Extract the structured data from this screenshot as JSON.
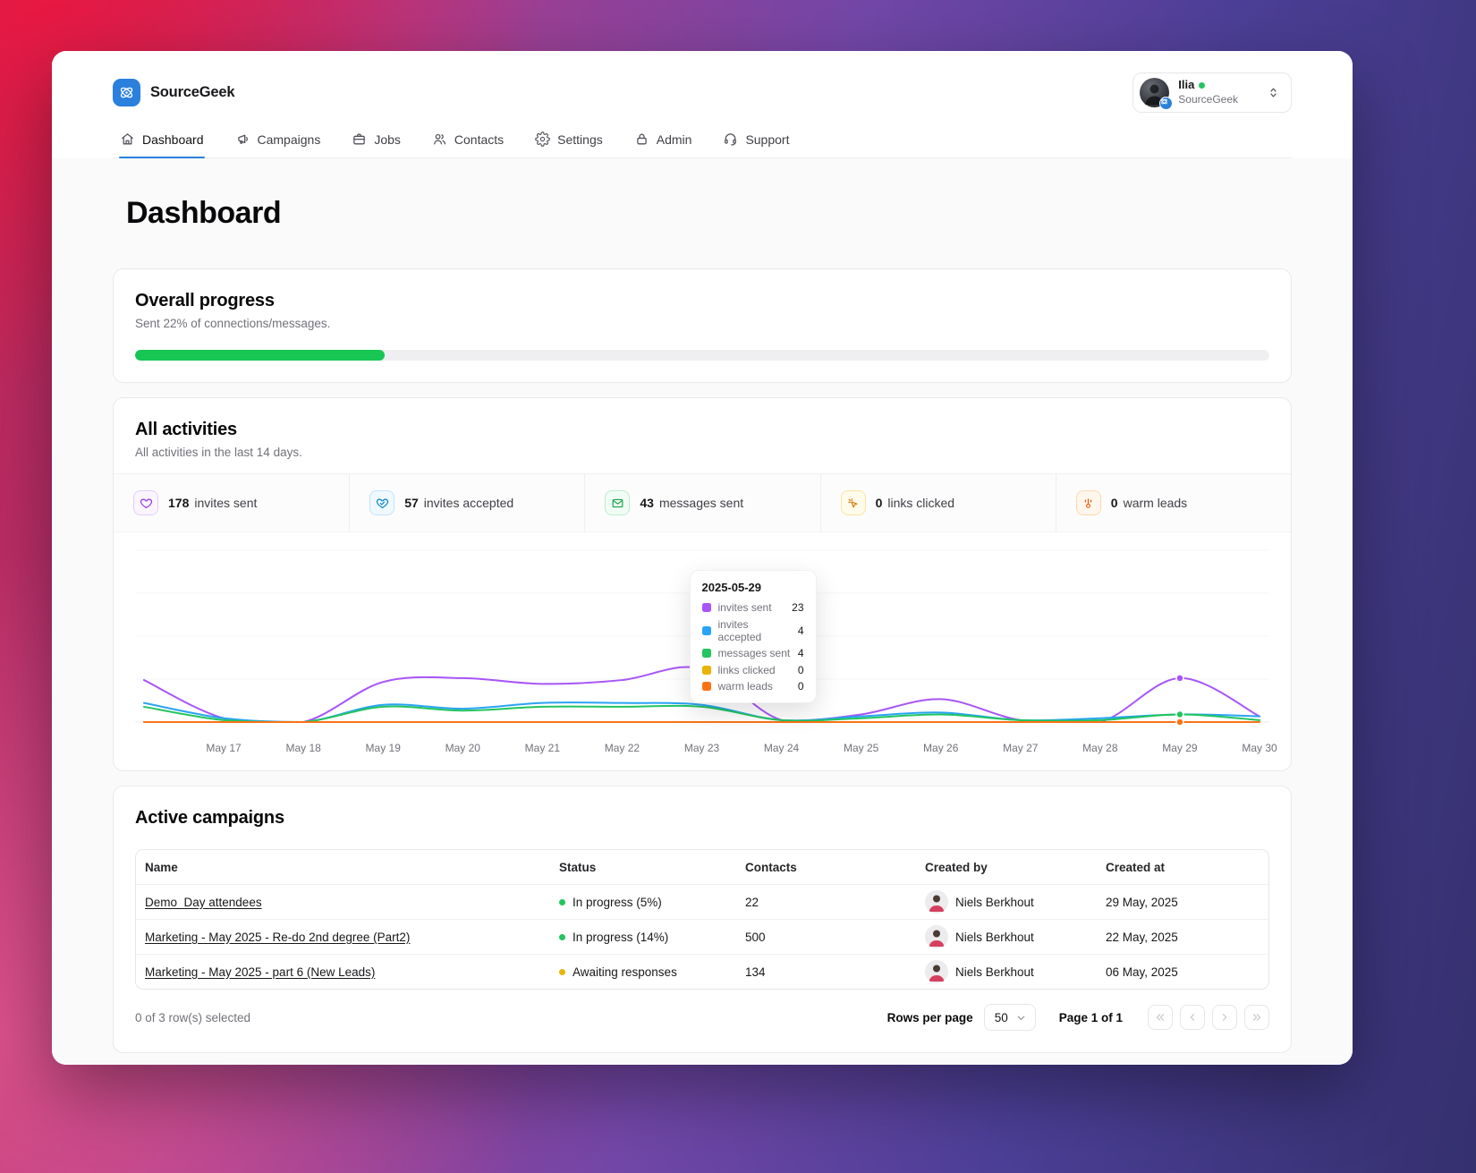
{
  "brand": {
    "name": "SourceGeek"
  },
  "account": {
    "name": "Ilia",
    "org": "SourceGeek",
    "status_color": "#22c55e"
  },
  "nav": {
    "items": [
      {
        "label": "Dashboard",
        "active": true
      },
      {
        "label": "Campaigns",
        "active": false
      },
      {
        "label": "Jobs",
        "active": false
      },
      {
        "label": "Contacts",
        "active": false
      },
      {
        "label": "Settings",
        "active": false
      },
      {
        "label": "Admin",
        "active": false
      },
      {
        "label": "Support",
        "active": false
      }
    ]
  },
  "page": {
    "title": "Dashboard"
  },
  "overall_progress": {
    "title": "Overall progress",
    "subtitle": "Sent 22% of connections/messages.",
    "percent": 22,
    "bar_color": "#17c653"
  },
  "activities": {
    "title": "All activities",
    "subtitle": "All activities in the last 14 days.",
    "stats": [
      {
        "value": "178",
        "label": "invites sent"
      },
      {
        "value": "57",
        "label": "invites accepted"
      },
      {
        "value": "43",
        "label": "messages sent"
      },
      {
        "value": "0",
        "label": "links clicked"
      },
      {
        "value": "0",
        "label": "warm leads"
      }
    ]
  },
  "chart_data": {
    "type": "line",
    "title": "All activities (last 14 days)",
    "xlabel": "",
    "ylabel": "",
    "ylim": [
      0,
      90
    ],
    "grid": true,
    "legend_position": "tooltip-only",
    "categories": [
      "May 17",
      "May 18",
      "May 19",
      "May 20",
      "May 21",
      "May 22",
      "May 23",
      "May 24",
      "May 25",
      "May 26",
      "May 27",
      "May 28",
      "May 29",
      "May 30"
    ],
    "note": "lines begin at unlabeled left edge (May 16); edge value given per series",
    "series": [
      {
        "name": "invites sent",
        "color": "#a855f7",
        "edge": 22,
        "values": [
          2,
          0,
          21,
          23,
          20,
          22,
          28,
          1,
          4,
          12,
          1,
          0,
          23,
          3
        ]
      },
      {
        "name": "invites accepted",
        "color": "#29a3f4",
        "edge": 10,
        "values": [
          2,
          0,
          9,
          7,
          10,
          10,
          9,
          1,
          3,
          5,
          1,
          2,
          4,
          3
        ]
      },
      {
        "name": "messages sent",
        "color": "#22c55e",
        "edge": 8,
        "values": [
          1,
          0,
          8,
          6,
          8,
          8,
          8,
          1,
          2,
          4,
          1,
          1,
          4,
          1
        ]
      },
      {
        "name": "links clicked",
        "color": "#eab308",
        "edge": 0,
        "values": [
          0,
          0,
          0,
          0,
          0,
          0,
          0,
          0,
          0,
          0,
          0,
          0,
          0,
          0
        ]
      },
      {
        "name": "warm leads",
        "color": "#f97316",
        "edge": 0,
        "values": [
          0,
          0,
          0,
          0,
          0,
          0,
          0,
          0,
          0,
          0,
          0,
          0,
          0,
          0
        ]
      }
    ],
    "tooltip": {
      "date": "2025-05-29",
      "hover_index": 12,
      "rows": [
        {
          "label": "invites sent",
          "value": "23",
          "color": "#a855f7"
        },
        {
          "label": "invites accepted",
          "value": "4",
          "color": "#29a3f4"
        },
        {
          "label": "messages sent",
          "value": "4",
          "color": "#22c55e"
        },
        {
          "label": "links clicked",
          "value": "0",
          "color": "#eab308"
        },
        {
          "label": "warm leads",
          "value": "0",
          "color": "#f97316"
        }
      ],
      "marker_series": [
        "invites sent",
        "messages sent",
        "warm leads"
      ]
    }
  },
  "campaigns": {
    "title": "Active campaigns",
    "columns": [
      "Name",
      "Status",
      "Contacts",
      "Created by",
      "Created at"
    ],
    "rows": [
      {
        "name": "Demo_Day attendees",
        "status": "In progress (5%)",
        "status_color": "#22c55e",
        "contacts": "22",
        "created_by": "Niels Berkhout",
        "created_at": "29 May, 2025"
      },
      {
        "name": "Marketing - May 2025 - Re-do 2nd degree (Part2)",
        "status": "In progress (14%)",
        "status_color": "#22c55e",
        "contacts": "500",
        "created_by": "Niels Berkhout",
        "created_at": "22 May, 2025"
      },
      {
        "name": "Marketing - May 2025 - part 6 (New Leads)",
        "status": "Awaiting responses",
        "status_color": "#eab308",
        "contacts": "134",
        "created_by": "Niels Berkhout",
        "created_at": "06 May, 2025"
      }
    ],
    "footer": {
      "selection": "0 of 3 row(s) selected",
      "rows_per_page_label": "Rows per page",
      "rows_per_page_value": "50",
      "page_info": "Page 1 of 1"
    }
  }
}
